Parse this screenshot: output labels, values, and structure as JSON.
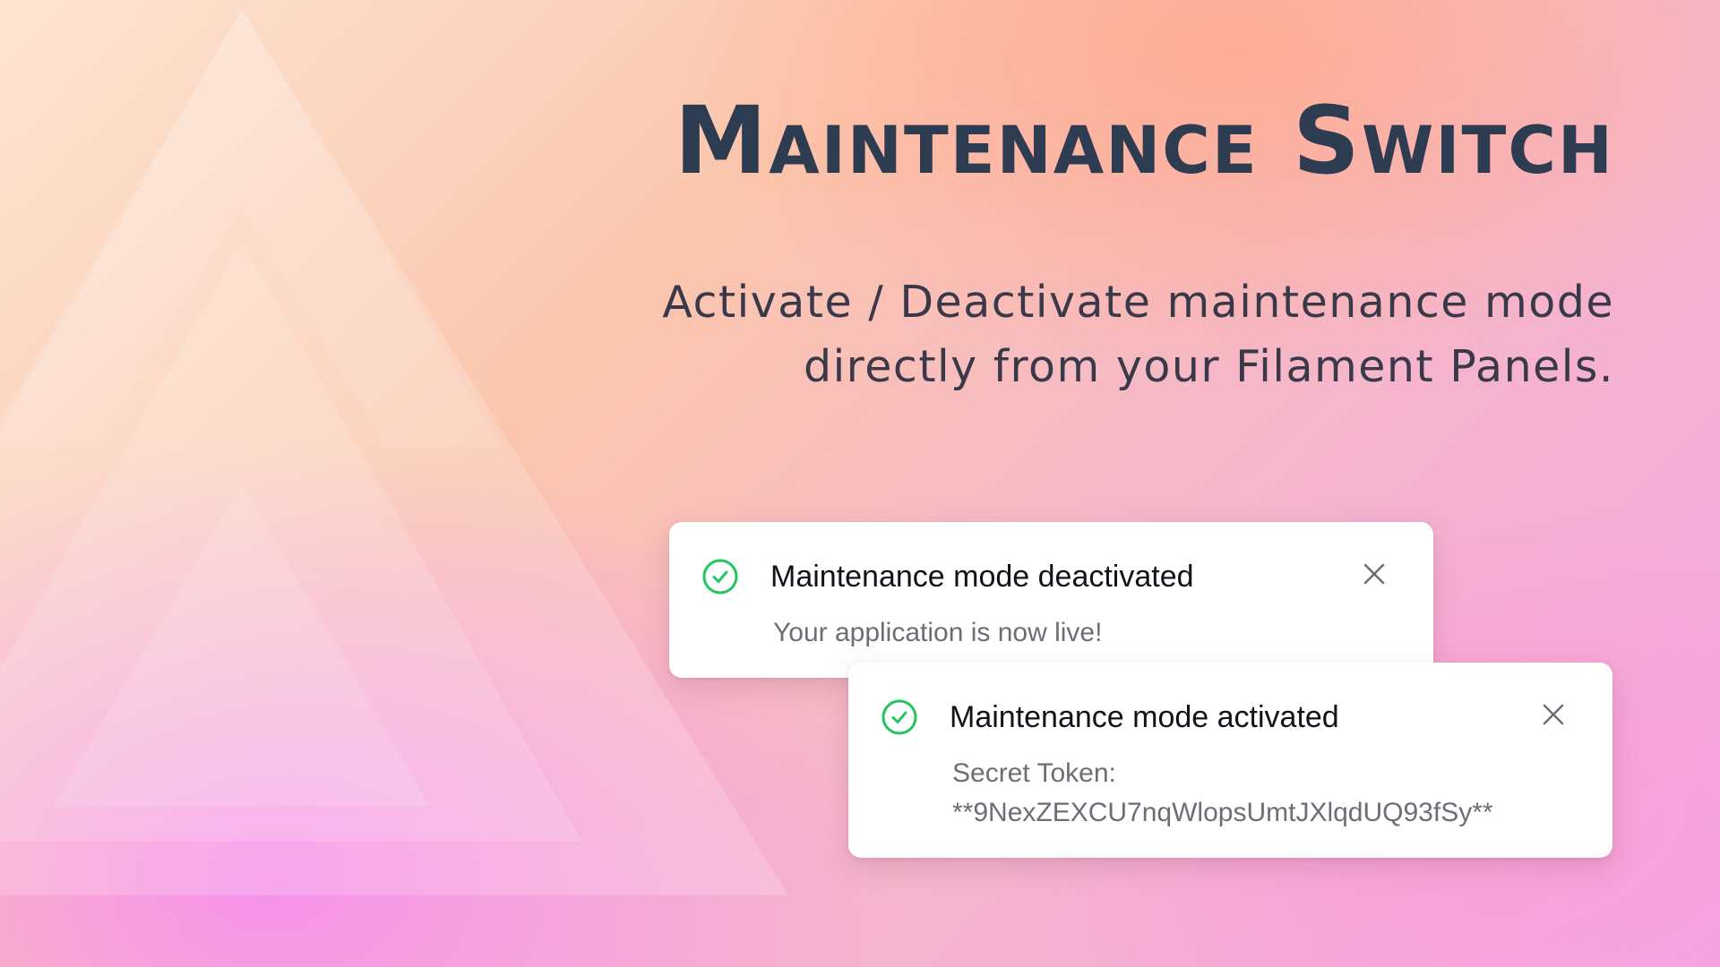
{
  "header": {
    "title": "Maintenance Switch",
    "subtitle_line1": "Activate / Deactivate maintenance mode",
    "subtitle_line2": "directly from your Filament Panels."
  },
  "notifications": [
    {
      "title": "Maintenance mode deactivated",
      "body": "Your application is now live!",
      "status_icon": "check-circle-icon",
      "close_icon": "close-icon"
    },
    {
      "title": "Maintenance mode activated",
      "body_label": "Secret Token:",
      "body_token": "**9NexZEXCU7nqWlopsUmtJXlqdUQ93fSy**",
      "status_icon": "check-circle-icon",
      "close_icon": "close-icon"
    }
  ],
  "colors": {
    "title": "#2e3c52",
    "success": "#22c55e",
    "muted_text": "#6b6e74"
  }
}
